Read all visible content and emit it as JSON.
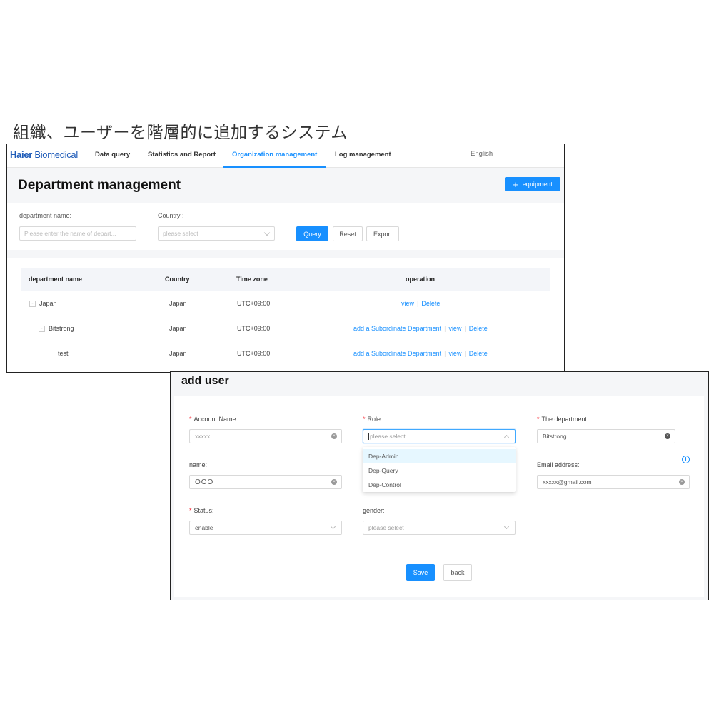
{
  "caption": "組織、ユーザーを階層的に追加するシステム",
  "window1": {
    "logo": {
      "brand": "Haier",
      "sub": "Biomedical"
    },
    "nav": [
      "Data query",
      "Statistics and Report",
      "Organization management",
      "Log management"
    ],
    "language": "English",
    "page_title": "Department management",
    "equipment_button": "equipment",
    "filters": {
      "department_label": "department name:",
      "department_placeholder": "Please enter the name of depart...",
      "country_label": "Country :",
      "country_placeholder": "please select",
      "query_button": "Query",
      "reset_button": "Reset",
      "export_button": "Export"
    },
    "table": {
      "headers": [
        "department name",
        "Country",
        "Time zone",
        "operation"
      ],
      "rows": [
        {
          "expander": "-",
          "name": "Japan",
          "country": "Japan",
          "timezone": "UTC+09:00",
          "ops": [
            "view",
            "Delete"
          ]
        },
        {
          "expander": "-",
          "name": "Bitstrong",
          "country": "Japan",
          "timezone": "UTC+09:00",
          "ops": [
            "add a Subordinate Department",
            "view",
            "Delete"
          ]
        },
        {
          "expander": "",
          "name": "test",
          "country": "Japan",
          "timezone": "UTC+09:00",
          "ops": [
            "add a Subordinate Department",
            "view",
            "Delete"
          ]
        }
      ]
    }
  },
  "window2": {
    "title": "add user",
    "required_mark": "*",
    "fields": {
      "account_name": {
        "label": "Account Name:",
        "value": "xxxxx"
      },
      "role": {
        "label": "Role:",
        "placeholder": "please select"
      },
      "department": {
        "label": "The department:",
        "value": "Bitstrong"
      },
      "name": {
        "label": "name:",
        "value": "OOO"
      },
      "email": {
        "label": "Email address:",
        "value": "xxxxx@gmail.com"
      },
      "status": {
        "label": "Status:",
        "value": "enable"
      },
      "gender": {
        "label": "gender:",
        "placeholder": "please select"
      }
    },
    "role_options": [
      "Dep-Admin",
      "Dep-Query",
      "Dep-Control"
    ],
    "save_button": "Save",
    "back_button": "back"
  },
  "colors": {
    "primary": "#1890ff",
    "brand": "#1e5bb8",
    "required": "#f5222d"
  }
}
